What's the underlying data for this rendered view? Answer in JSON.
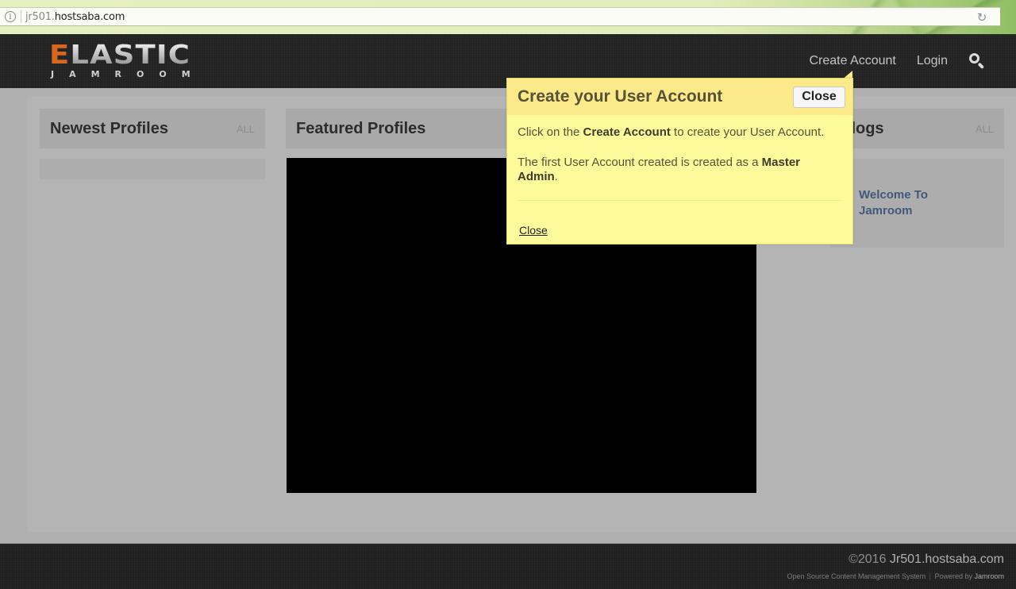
{
  "browser": {
    "url_subdomain": "jr501.",
    "url_domain": "hostsaba.com",
    "info_icon": "info-icon",
    "reload_icon": "reload-icon"
  },
  "header": {
    "logo_first_letter": "E",
    "logo_rest": "LASTIC",
    "logo_sub": "JAMROOM",
    "nav": [
      {
        "label": "Create Account"
      },
      {
        "label": "Login"
      }
    ],
    "search_icon": "search-icon"
  },
  "columns": {
    "newest": {
      "title": "Newest Profiles",
      "all_label": "ALL"
    },
    "featured": {
      "title": "Featured Profiles"
    },
    "blogs": {
      "title": "Blogs",
      "all_label": "ALL",
      "items": [
        {
          "title": "Welcome To Jamroom"
        }
      ]
    }
  },
  "tooltip": {
    "title": "Create your User Account",
    "close_button": "Close",
    "line1_pre": "Click on the ",
    "line1_bold": "Create Account",
    "line1_post": " to create your User Account.",
    "line2_pre": "The first User Account created is created as a ",
    "line2_bold": "Master Admin",
    "line2_post": ".",
    "close_link": "Close"
  },
  "footer": {
    "copyright_prefix": "©2016 ",
    "copyright_site": "Jr501.hostsaba.com",
    "tagline": "Open Source Content Management System",
    "separator": "|",
    "powered_prefix": "Powered by ",
    "powered_link": "Jamroom"
  },
  "colors": {
    "accent_orange": "#d9661d",
    "tooltip_bg": "#fdfa9c",
    "tooltip_header": "#fbe98a",
    "blog_link": "#41597a"
  }
}
